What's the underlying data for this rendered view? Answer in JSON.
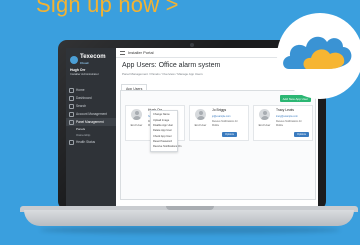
{
  "banner": {
    "cta": "Sign up now >"
  },
  "app": {
    "logo": {
      "name": "Texecom",
      "sub": "Cloud"
    },
    "user": {
      "name": "Hugh Orr",
      "detail": "Installer Administrator"
    },
    "topbar_title": "Installer Portal",
    "page_title": "App Users: Office alarm system",
    "breadcrumb": "Panel Management  /  Panels  /  Overview  /  Manage App Users",
    "tab": "App Users",
    "add_button": "Add New App User",
    "nav": [
      {
        "label": "Home"
      },
      {
        "label": "Dashboard"
      },
      {
        "label": "Search"
      },
      {
        "label": "Account Management"
      },
      {
        "label": "Panel Management"
      },
      {
        "label": "Panels"
      },
      {
        "label": "Ownership"
      },
      {
        "label": "Health Status"
      }
    ],
    "cards": [
      {
        "name": "Hugh Orr",
        "role": "End User",
        "email": "hugh@example.com",
        "line2": "Receive Notifications for",
        "line3": "Mobile",
        "action": "Options"
      },
      {
        "name": "Jo Briggs",
        "role": "End User",
        "email": "jo@example.com",
        "line2": "Receive Notifications for",
        "line3": "Mobile",
        "action": "Options"
      },
      {
        "name": "Tracy Lewis",
        "role": "End User",
        "email": "tracy@example.com",
        "line2": "Receive Notifications for",
        "line3": "Mobile",
        "action": "Options"
      }
    ],
    "menu": [
      "Change Name",
      "Upload Image",
      "Disable App User",
      "Delete App User",
      "Check App User",
      "Reset Password",
      "Receive Notifications On"
    ]
  },
  "colors": {
    "background": "#3a9fde",
    "cta": "#f2b233",
    "cloud_blue": "#3a93d4",
    "cloud_yellow": "#f6b532"
  },
  "icons": [
    "cloud-logo-icon",
    "hamburger-icon",
    "user-avatar-icon"
  ]
}
